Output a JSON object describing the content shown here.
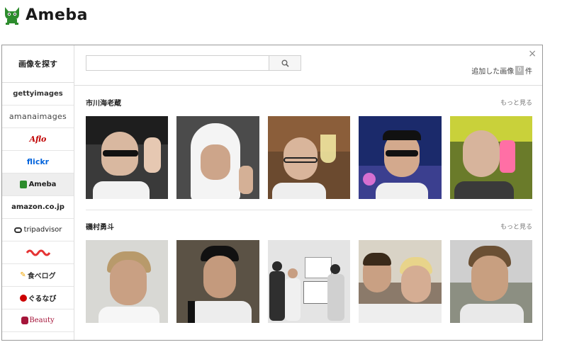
{
  "header": {
    "logo_text": "Ameba"
  },
  "sidebar": {
    "title": "画像を探す",
    "sources": [
      {
        "label": "gettyimages",
        "color": "#333333"
      },
      {
        "label": "amanaimages",
        "color": "#444444"
      },
      {
        "label": "Aflo",
        "color": "#c00000"
      },
      {
        "label": "flickr",
        "color": "#0063dc"
      },
      {
        "label": "Ameba",
        "color": "#2d8c2d"
      },
      {
        "label": "amazon.co.jp",
        "color": "#222222"
      },
      {
        "label": "tripadvisor",
        "color": "#222222"
      },
      {
        "label": "～～",
        "color": "#e53333"
      },
      {
        "label": "食べログ",
        "color": "#333333"
      },
      {
        "label": "ぐるなび",
        "color": "#222222"
      },
      {
        "label": "Beauty",
        "color": "#a5153a"
      }
    ]
  },
  "search": {
    "value": "",
    "placeholder": ""
  },
  "added": {
    "prefix": "追加した画像",
    "count": "0",
    "suffix": "件"
  },
  "close_label": "×",
  "sections": [
    {
      "title": "市川海老蔵",
      "more": "もっと見る"
    },
    {
      "title": "磯村勇斗",
      "more": "もっと見る"
    }
  ],
  "colors": {
    "ameba_green": "#2d8c2d",
    "active_bg": "#eeeeee"
  }
}
